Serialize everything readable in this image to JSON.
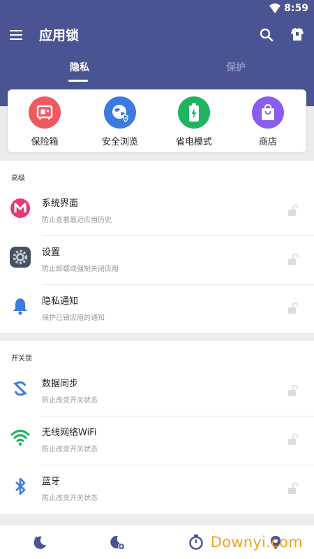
{
  "status": {
    "time": "8:59"
  },
  "appbar": {
    "title": "应用锁"
  },
  "tabs": [
    {
      "label": "隐私"
    },
    {
      "label": "保护"
    }
  ],
  "quick_actions": [
    {
      "label": "保险箱",
      "color": "#ee5a5f",
      "icon": "safe-icon"
    },
    {
      "label": "安全浏览",
      "color": "#3b7be0",
      "icon": "globe-shield-icon"
    },
    {
      "label": "省电模式",
      "color": "#1fb45f",
      "icon": "battery-icon"
    },
    {
      "label": "商店",
      "color": "#8a5cf0",
      "icon": "shopping-bag-icon"
    }
  ],
  "sections": [
    {
      "header": "高级",
      "items": [
        {
          "title": "系统界面",
          "subtitle": "防止查看最近应用历史",
          "icon": "recents-icon"
        },
        {
          "title": "设置",
          "subtitle": "防止卸载或强制关闭应用",
          "icon": "settings-gear-icon"
        },
        {
          "title": "隐私通知",
          "subtitle": "保护已锁应用的通知",
          "icon": "bell-icon"
        }
      ]
    },
    {
      "header": "开关锁",
      "items": [
        {
          "title": "数据同步",
          "subtitle": "防止改变开关状态",
          "icon": "sync-icon"
        },
        {
          "title": "无线网络WiFi",
          "subtitle": "防止改变开关状态",
          "icon": "wifi-icon"
        },
        {
          "title": "蓝牙",
          "subtitle": "防止改变开关状态",
          "icon": "bluetooth-icon"
        }
      ]
    }
  ],
  "watermark": "Downyi.com"
}
